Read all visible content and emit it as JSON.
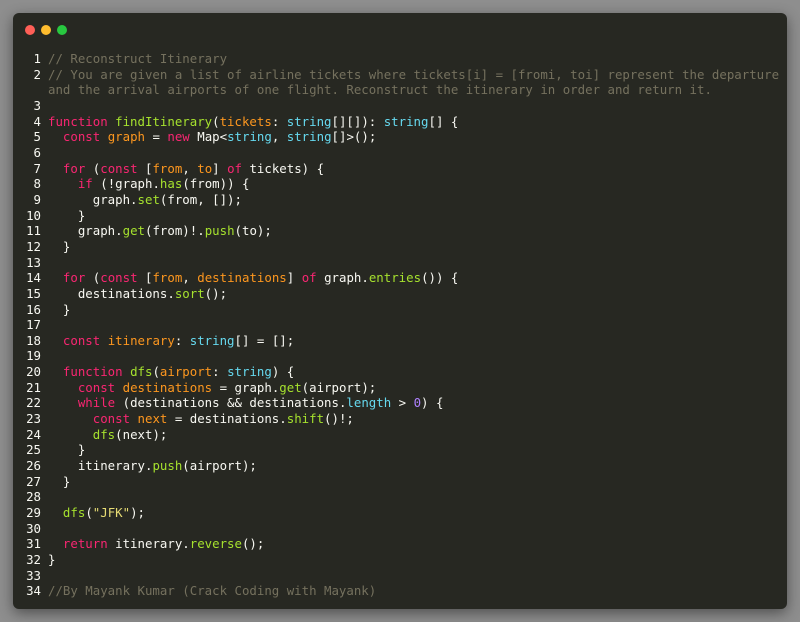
{
  "window": {
    "controls": [
      "close",
      "minimize",
      "maximize"
    ],
    "colors": {
      "background": "#272822",
      "close": "#ff5f57",
      "minimize": "#febc2e",
      "maximize": "#28c840"
    }
  },
  "editor": {
    "language": "TypeScript",
    "lines": [
      {
        "n": "1",
        "tokens": [
          {
            "t": "// Reconstruct Itinerary",
            "c": "cm"
          }
        ]
      },
      {
        "n": "2",
        "tokens": [
          {
            "t": "// You are given a list of airline tickets where tickets[i] = [fromi, toi] represent the departure",
            "c": "cm"
          }
        ]
      },
      {
        "n": "",
        "tokens": [
          {
            "t": "and the arrival airports of one flight. Reconstruct the itinerary in order and return it.",
            "c": "cm"
          }
        ]
      },
      {
        "n": "3",
        "tokens": []
      },
      {
        "n": "4",
        "tokens": [
          {
            "t": "function ",
            "c": "kw"
          },
          {
            "t": "findItinerary",
            "c": "fn"
          },
          {
            "t": "(",
            "c": ""
          },
          {
            "t": "tickets",
            "c": "pa"
          },
          {
            "t": ": ",
            "c": ""
          },
          {
            "t": "string",
            "c": "ty"
          },
          {
            "t": "[][]): ",
            "c": ""
          },
          {
            "t": "string",
            "c": "ty"
          },
          {
            "t": "[] {",
            "c": ""
          }
        ]
      },
      {
        "n": "5",
        "tokens": [
          {
            "t": "  ",
            "c": ""
          },
          {
            "t": "const ",
            "c": "kw"
          },
          {
            "t": "graph",
            "c": "pa"
          },
          {
            "t": " = ",
            "c": ""
          },
          {
            "t": "new ",
            "c": "kw"
          },
          {
            "t": "Map<",
            "c": ""
          },
          {
            "t": "string",
            "c": "ty"
          },
          {
            "t": ", ",
            "c": ""
          },
          {
            "t": "string",
            "c": "ty"
          },
          {
            "t": "[]>();",
            "c": ""
          }
        ]
      },
      {
        "n": "6",
        "tokens": []
      },
      {
        "n": "7",
        "tokens": [
          {
            "t": "  ",
            "c": ""
          },
          {
            "t": "for ",
            "c": "kw"
          },
          {
            "t": "(",
            "c": ""
          },
          {
            "t": "const ",
            "c": "kw"
          },
          {
            "t": "[",
            "c": ""
          },
          {
            "t": "from",
            "c": "pa"
          },
          {
            "t": ", ",
            "c": ""
          },
          {
            "t": "to",
            "c": "pa"
          },
          {
            "t": "] ",
            "c": ""
          },
          {
            "t": "of ",
            "c": "kw"
          },
          {
            "t": "tickets) {",
            "c": ""
          }
        ]
      },
      {
        "n": "8",
        "tokens": [
          {
            "t": "    ",
            "c": ""
          },
          {
            "t": "if ",
            "c": "kw"
          },
          {
            "t": "(!graph.",
            "c": ""
          },
          {
            "t": "has",
            "c": "fn"
          },
          {
            "t": "(from)) {",
            "c": ""
          }
        ]
      },
      {
        "n": "9",
        "tokens": [
          {
            "t": "      graph.",
            "c": ""
          },
          {
            "t": "set",
            "c": "fn"
          },
          {
            "t": "(from, []);",
            "c": ""
          }
        ]
      },
      {
        "n": "10",
        "tokens": [
          {
            "t": "    }",
            "c": ""
          }
        ]
      },
      {
        "n": "11",
        "tokens": [
          {
            "t": "    graph.",
            "c": ""
          },
          {
            "t": "get",
            "c": "fn"
          },
          {
            "t": "(from)!.",
            "c": ""
          },
          {
            "t": "push",
            "c": "fn"
          },
          {
            "t": "(to);",
            "c": ""
          }
        ]
      },
      {
        "n": "12",
        "tokens": [
          {
            "t": "  }",
            "c": ""
          }
        ]
      },
      {
        "n": "13",
        "tokens": []
      },
      {
        "n": "14",
        "tokens": [
          {
            "t": "  ",
            "c": ""
          },
          {
            "t": "for ",
            "c": "kw"
          },
          {
            "t": "(",
            "c": ""
          },
          {
            "t": "const ",
            "c": "kw"
          },
          {
            "t": "[",
            "c": ""
          },
          {
            "t": "from",
            "c": "pa"
          },
          {
            "t": ", ",
            "c": ""
          },
          {
            "t": "destinations",
            "c": "pa"
          },
          {
            "t": "] ",
            "c": ""
          },
          {
            "t": "of ",
            "c": "kw"
          },
          {
            "t": "graph.",
            "c": ""
          },
          {
            "t": "entries",
            "c": "fn"
          },
          {
            "t": "()) {",
            "c": ""
          }
        ]
      },
      {
        "n": "15",
        "tokens": [
          {
            "t": "    destinations.",
            "c": ""
          },
          {
            "t": "sort",
            "c": "fn"
          },
          {
            "t": "();",
            "c": ""
          }
        ]
      },
      {
        "n": "16",
        "tokens": [
          {
            "t": "  }",
            "c": ""
          }
        ]
      },
      {
        "n": "17",
        "tokens": []
      },
      {
        "n": "18",
        "tokens": [
          {
            "t": "  ",
            "c": ""
          },
          {
            "t": "const ",
            "c": "kw"
          },
          {
            "t": "itinerary",
            "c": "pa"
          },
          {
            "t": ": ",
            "c": ""
          },
          {
            "t": "string",
            "c": "ty"
          },
          {
            "t": "[] = [];",
            "c": ""
          }
        ]
      },
      {
        "n": "19",
        "tokens": []
      },
      {
        "n": "20",
        "tokens": [
          {
            "t": "  ",
            "c": ""
          },
          {
            "t": "function ",
            "c": "kw"
          },
          {
            "t": "dfs",
            "c": "fn"
          },
          {
            "t": "(",
            "c": ""
          },
          {
            "t": "airport",
            "c": "pa"
          },
          {
            "t": ": ",
            "c": ""
          },
          {
            "t": "string",
            "c": "ty"
          },
          {
            "t": ") {",
            "c": ""
          }
        ]
      },
      {
        "n": "21",
        "tokens": [
          {
            "t": "    ",
            "c": ""
          },
          {
            "t": "const ",
            "c": "kw"
          },
          {
            "t": "destinations",
            "c": "pa"
          },
          {
            "t": " = graph.",
            "c": ""
          },
          {
            "t": "get",
            "c": "fn"
          },
          {
            "t": "(airport);",
            "c": ""
          }
        ]
      },
      {
        "n": "22",
        "tokens": [
          {
            "t": "    ",
            "c": ""
          },
          {
            "t": "while ",
            "c": "kw"
          },
          {
            "t": "(destinations && destinations.",
            "c": ""
          },
          {
            "t": "length",
            "c": "ty"
          },
          {
            "t": " > ",
            "c": ""
          },
          {
            "t": "0",
            "c": "nu"
          },
          {
            "t": ") {",
            "c": ""
          }
        ]
      },
      {
        "n": "23",
        "tokens": [
          {
            "t": "      ",
            "c": ""
          },
          {
            "t": "const ",
            "c": "kw"
          },
          {
            "t": "next",
            "c": "pa"
          },
          {
            "t": " = destinations.",
            "c": ""
          },
          {
            "t": "shift",
            "c": "fn"
          },
          {
            "t": "()!;",
            "c": ""
          }
        ]
      },
      {
        "n": "24",
        "tokens": [
          {
            "t": "      ",
            "c": ""
          },
          {
            "t": "dfs",
            "c": "fn"
          },
          {
            "t": "(next);",
            "c": ""
          }
        ]
      },
      {
        "n": "25",
        "tokens": [
          {
            "t": "    }",
            "c": ""
          }
        ]
      },
      {
        "n": "26",
        "tokens": [
          {
            "t": "    itinerary.",
            "c": ""
          },
          {
            "t": "push",
            "c": "fn"
          },
          {
            "t": "(airport);",
            "c": ""
          }
        ]
      },
      {
        "n": "27",
        "tokens": [
          {
            "t": "  }",
            "c": ""
          }
        ]
      },
      {
        "n": "28",
        "tokens": []
      },
      {
        "n": "29",
        "tokens": [
          {
            "t": "  ",
            "c": ""
          },
          {
            "t": "dfs",
            "c": "fn"
          },
          {
            "t": "(",
            "c": ""
          },
          {
            "t": "\"JFK\"",
            "c": "st"
          },
          {
            "t": ");",
            "c": ""
          }
        ]
      },
      {
        "n": "30",
        "tokens": []
      },
      {
        "n": "31",
        "tokens": [
          {
            "t": "  ",
            "c": ""
          },
          {
            "t": "return ",
            "c": "kw"
          },
          {
            "t": "itinerary.",
            "c": ""
          },
          {
            "t": "reverse",
            "c": "fn"
          },
          {
            "t": "();",
            "c": ""
          }
        ]
      },
      {
        "n": "32",
        "tokens": [
          {
            "t": "}",
            "c": ""
          }
        ]
      },
      {
        "n": "33",
        "tokens": []
      },
      {
        "n": "34",
        "tokens": [
          {
            "t": "//By Mayank Kumar (Crack Coding with Mayank)",
            "c": "cm"
          }
        ]
      }
    ]
  }
}
